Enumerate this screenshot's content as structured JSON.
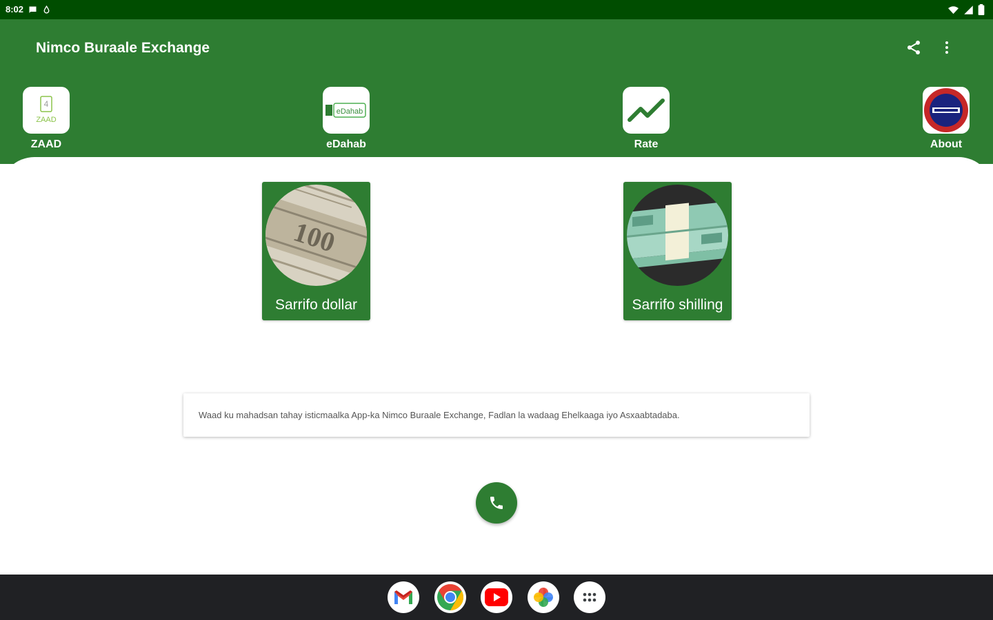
{
  "status_bar": {
    "time": "8:02",
    "left_icons": [
      "chat-icon",
      "water-drop-icon"
    ],
    "right_icons": [
      "wifi-icon",
      "signal-icon",
      "battery-icon"
    ]
  },
  "app_bar": {
    "title": "Nimco Buraale Exchange",
    "actions": [
      "share-icon",
      "more-vert-icon"
    ]
  },
  "quick_actions": [
    {
      "label": "ZAAD",
      "logo_text": "ZAAD"
    },
    {
      "label": "eDahab",
      "logo_text": "eDahab"
    },
    {
      "label": "Rate"
    },
    {
      "label": "About"
    }
  ],
  "exchange_cards": [
    {
      "label": "Sarrifo dollar"
    },
    {
      "label": "Sarrifo shilling"
    }
  ],
  "message": "Waad ku mahadsan tahay isticmaalka App-ka Nimco Buraale Exchange, Fadlan la wadaag Ehelkaaga iyo Asxaabtadaba.",
  "fab": {
    "icon": "phone-icon"
  },
  "dock": {
    "apps": [
      "gmail-icon",
      "chrome-icon",
      "youtube-icon",
      "photos-icon",
      "app-drawer-icon"
    ]
  },
  "colors": {
    "primary": "#2e7d32",
    "status_bar": "#004d00",
    "dock": "#202124",
    "rate_icon": "#2e7d32",
    "about_logo_red": "#c62828",
    "about_logo_blue": "#1a237e"
  }
}
